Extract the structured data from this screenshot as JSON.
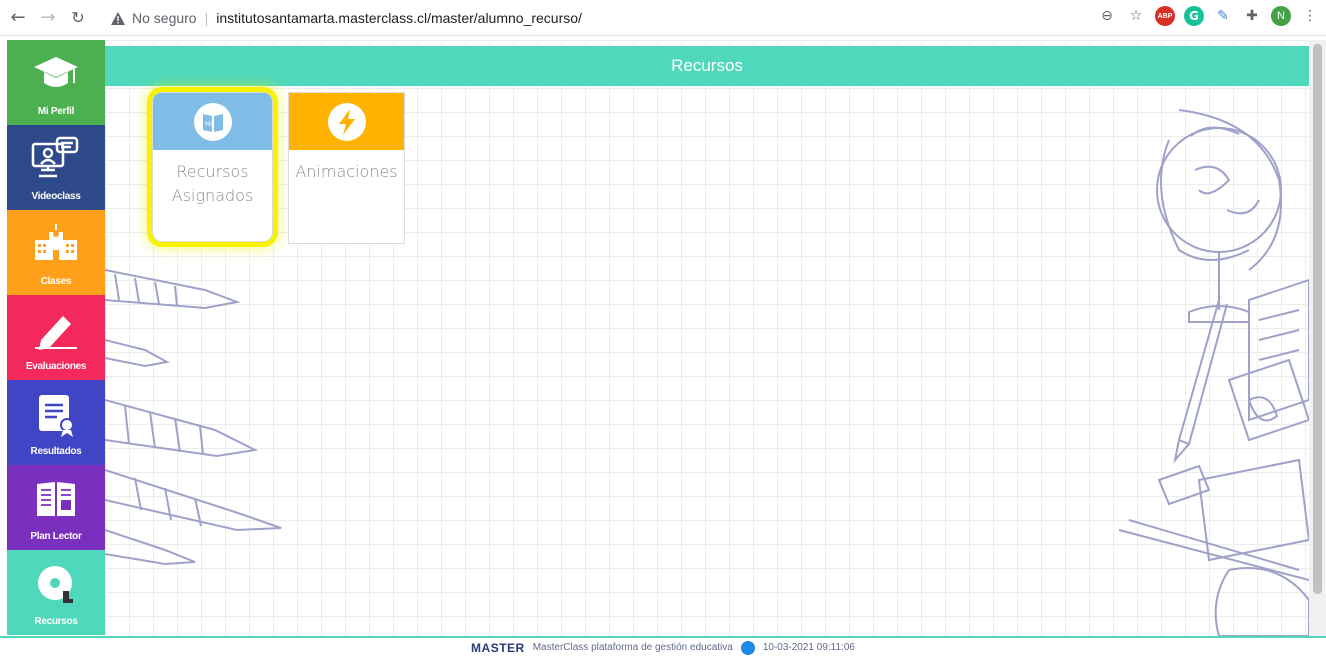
{
  "browser": {
    "back_icon": "arrow-left-icon",
    "forward_icon": "arrow-right-icon",
    "reload_icon": "reload-icon",
    "security_label": "No seguro",
    "url": "institutosantamarta.masterclass.cl/master/alumno_recurso/",
    "extensions": {
      "abp": "ABP",
      "grammarly": "G",
      "avatar": "N"
    }
  },
  "sidebar": {
    "items": [
      {
        "label": "Mi Perfil",
        "color": "#4caf50"
      },
      {
        "label": "Videoclass",
        "color": "#2f4a8a"
      },
      {
        "label": "Clases",
        "color": "#ff9f1a"
      },
      {
        "label": "Evaluaciones",
        "color": "#f2295a"
      },
      {
        "label": "Resultados",
        "color": "#3f45c4"
      },
      {
        "label": "Plan Lector",
        "color": "#7b2fbe"
      },
      {
        "label": "Recursos",
        "color": "#4fd8bb"
      }
    ]
  },
  "header": {
    "title": "Recursos"
  },
  "cards": [
    {
      "title_line1": "Recursos",
      "title_line2": "Asignados",
      "color": "#7fbde6",
      "selected": true
    },
    {
      "title_line1": "Animaciones",
      "title_line2": "",
      "color": "#ffb300",
      "selected": false
    }
  ],
  "footer": {
    "brand": "MASTER",
    "text": "MasterClass plataforma de gestión educativa",
    "timestamp": "10-03-2021 09:11:06"
  }
}
